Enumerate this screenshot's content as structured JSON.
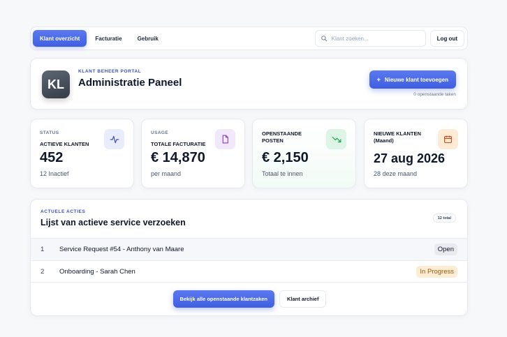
{
  "nav": {
    "tabs": [
      {
        "label": "Klant overzicht",
        "active": true
      },
      {
        "label": "Facturatie",
        "active": false
      },
      {
        "label": "Gebruik",
        "active": false
      }
    ],
    "search_placeholder": "Klant zoeken...",
    "logout_label": "Log out"
  },
  "header": {
    "avatar_initials": "KL",
    "eyebrow": "KLANT BEHEER PORTAL",
    "title": "Administratie Paneel",
    "add_button_label": "Nieuwe klant toevoegen",
    "pending_text": "0 openstaande taken"
  },
  "stats": [
    {
      "label": "STATUS",
      "sublabel": "ACTIEVE KLANTEN",
      "value": "452",
      "note": "12 Inactief",
      "icon": "activity-icon",
      "icon_color": "#3b4ec2",
      "icon_bg": "#e8ecfb"
    },
    {
      "label": "USAGE",
      "sublabel": "TOTALE FACTURATIE",
      "value": "€ 14,870",
      "note": "per maand",
      "icon": "document-icon",
      "icon_color": "#7e3fb8",
      "icon_bg": "#f1e8fb"
    },
    {
      "label": "OPENSTAANDE POSTEN",
      "value": "€ 2,150",
      "note": "Totaal te innen",
      "icon": "trending-down-icon",
      "icon_color": "#16a34a",
      "icon_bg": "#dcf5e6"
    },
    {
      "label": "NIEUWE KLANTEN (Maand)",
      "value": "27 aug 2026",
      "note": "28 deze maand",
      "icon": "calendar-icon",
      "icon_color": "#c2410c",
      "icon_bg": "#fdebd6"
    }
  ],
  "requests": {
    "eyebrow": "ACTUELE ACTIES",
    "title": "Lijst van actieve service verzoeken",
    "count_badge": "12 total",
    "rows": [
      {
        "num": "1",
        "text": "Service Request #54 - Anthony van Maare",
        "status": "Open"
      },
      {
        "num": "2",
        "text": "Onboarding - Sarah Chen",
        "status": "In Progress"
      }
    ],
    "view_all_label": "Bekijk alle openstaande klantzaken",
    "archive_label": "Klant archief"
  }
}
